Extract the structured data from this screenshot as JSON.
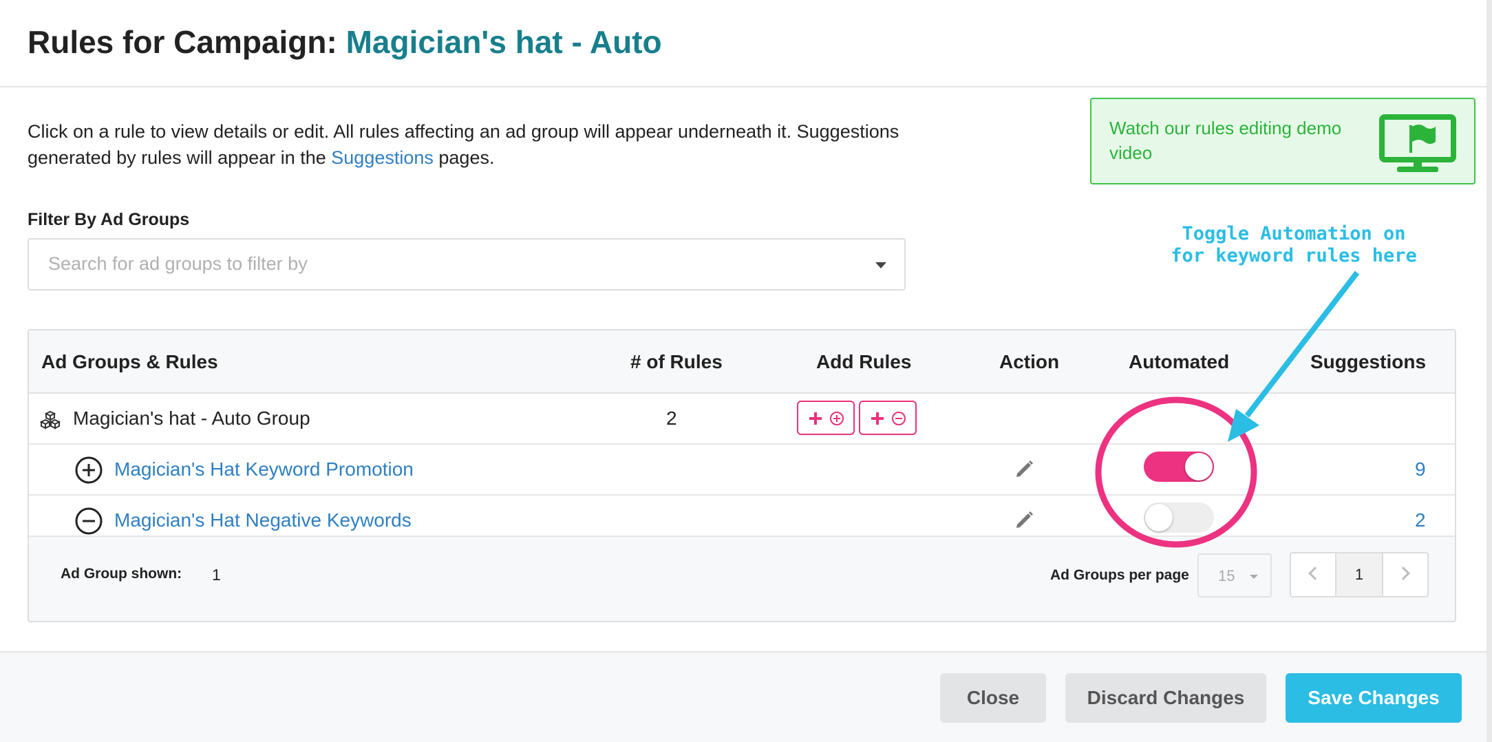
{
  "header": {
    "title_prefix": "Rules for Campaign: ",
    "campaign_name": "Magician's hat - Auto"
  },
  "intro": {
    "text_before": "Click on a rule to view details or edit. All rules affecting an ad group will appear underneath it. Suggestions generated by rules will appear in the ",
    "link": "Suggestions",
    "text_after": " pages."
  },
  "demo": {
    "text": "Watch our rules editing demo video",
    "icon": "monitor-flag-icon"
  },
  "filter": {
    "label": "Filter By Ad Groups",
    "placeholder": "Search for ad groups to filter by",
    "value": ""
  },
  "annotation": {
    "line1": "Toggle Automation on",
    "line2": "for keyword rules here"
  },
  "table": {
    "headers": [
      "Ad Groups & Rules",
      "# of Rules",
      "Add Rules",
      "Action",
      "Automated",
      "Suggestions"
    ],
    "group": {
      "name": "Magician's hat - Auto Group",
      "rule_count": "2",
      "icon": "cubes-icon"
    },
    "rules": [
      {
        "name": "Magician's Hat Keyword Promotion",
        "type": "plus-circle-icon",
        "automated": true,
        "suggestions": "9"
      },
      {
        "name": "Magician's Hat Negative Keywords",
        "type": "minus-circle-icon",
        "automated": false,
        "suggestions": "2"
      }
    ]
  },
  "pagination": {
    "shown_label": "Ad Group shown:",
    "shown_value": "1",
    "per_page_label": "Ad Groups per page",
    "per_page_value": "15",
    "current_page": "1"
  },
  "footer": {
    "close": "Close",
    "discard": "Discard Changes",
    "save": "Save Changes"
  },
  "colors": {
    "accent": "#2bbde4",
    "pink": "#e8327c",
    "link": "#2f7fc1",
    "teal": "#187f8c",
    "green": "#3ec54a"
  }
}
